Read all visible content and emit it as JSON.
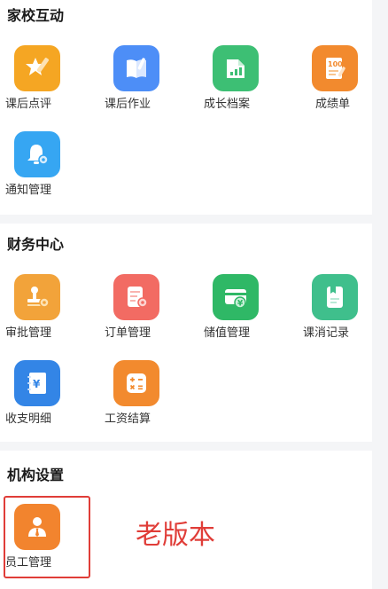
{
  "sections": [
    {
      "title": "家校互动",
      "items": [
        {
          "label": "课后点评",
          "icon": "pencil-star-icon",
          "color": "#f5a623"
        },
        {
          "label": "课后作业",
          "icon": "notebook-pen-icon",
          "color": "#4d8ef7"
        },
        {
          "label": "成长档案",
          "icon": "growth-chart-folder-icon",
          "color": "#3dbf74"
        },
        {
          "label": "成绩单",
          "icon": "score-sheet-icon",
          "color": "#f28a2e"
        },
        {
          "label": "通知管理",
          "icon": "bell-gear-icon",
          "color": "#36a6f2"
        }
      ]
    },
    {
      "title": "财务中心",
      "items": [
        {
          "label": "审批管理",
          "icon": "stamp-gear-icon",
          "color": "#f2a33a"
        },
        {
          "label": "订单管理",
          "icon": "order-gear-icon",
          "color": "#f26b63"
        },
        {
          "label": "储值管理",
          "icon": "wallet-yen-icon",
          "color": "#2fb866"
        },
        {
          "label": "课消记录",
          "icon": "record-book-icon",
          "color": "#3fbf8c"
        },
        {
          "label": "收支明细",
          "icon": "ledger-yen-icon",
          "color": "#3385e6"
        },
        {
          "label": "工资结算",
          "icon": "calculator-icon",
          "color": "#f28a2e"
        }
      ]
    },
    {
      "title": "机构设置",
      "items": [
        {
          "label": "员工管理",
          "icon": "staff-person-icon",
          "color": "#f2842e"
        }
      ]
    }
  ],
  "annotation": {
    "text": "老版本",
    "color": "#e03d38"
  }
}
